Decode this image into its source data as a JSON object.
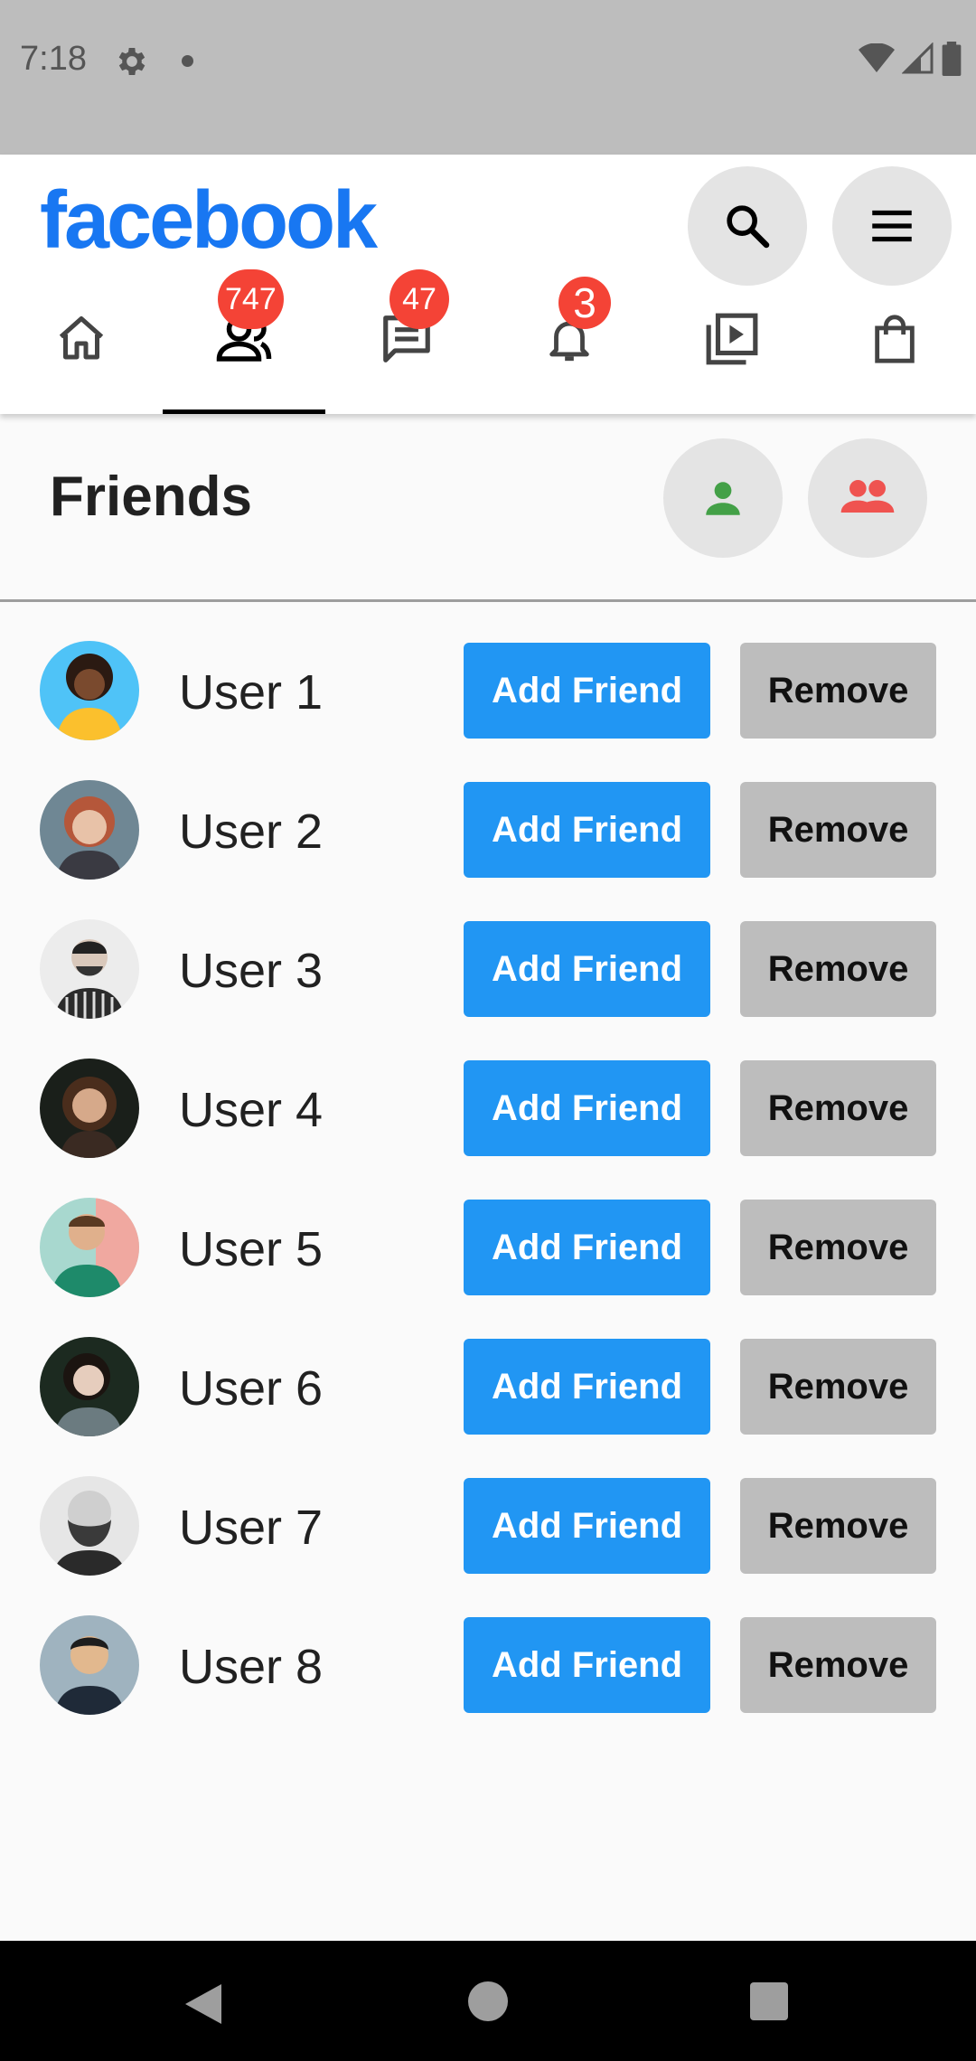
{
  "status_bar": {
    "time": "7:18"
  },
  "header": {
    "logo": "facebook",
    "search_icon": "search-icon",
    "menu_icon": "menu-icon"
  },
  "tabs": [
    {
      "name": "home",
      "icon": "home-icon",
      "badge": ""
    },
    {
      "name": "friends",
      "icon": "friends-icon",
      "badge": "747",
      "active": true
    },
    {
      "name": "messages",
      "icon": "message-icon",
      "badge": "47"
    },
    {
      "name": "notifications",
      "icon": "bell-icon",
      "badge": "3"
    },
    {
      "name": "watch",
      "icon": "video-icon",
      "badge": ""
    },
    {
      "name": "marketplace",
      "icon": "shop-icon",
      "badge": ""
    }
  ],
  "friends": {
    "title": "Friends",
    "users": [
      {
        "name": "User 1",
        "add": "Add Friend",
        "remove": "Remove"
      },
      {
        "name": "User 2",
        "add": "Add Friend",
        "remove": "Remove"
      },
      {
        "name": "User 3",
        "add": "Add Friend",
        "remove": "Remove"
      },
      {
        "name": "User 4",
        "add": "Add Friend",
        "remove": "Remove"
      },
      {
        "name": "User 5",
        "add": "Add Friend",
        "remove": "Remove"
      },
      {
        "name": "User 6",
        "add": "Add Friend",
        "remove": "Remove"
      },
      {
        "name": "User 7",
        "add": "Add Friend",
        "remove": "Remove"
      },
      {
        "name": "User 8",
        "add": "Add Friend",
        "remove": "Remove"
      }
    ]
  },
  "colors": {
    "brand": "#1877f2",
    "add_button": "#2196f3",
    "remove_button": "#bdbdbd",
    "badge": "#f44336",
    "person_icon": "#43a047",
    "group_icon": "#ef5350"
  }
}
